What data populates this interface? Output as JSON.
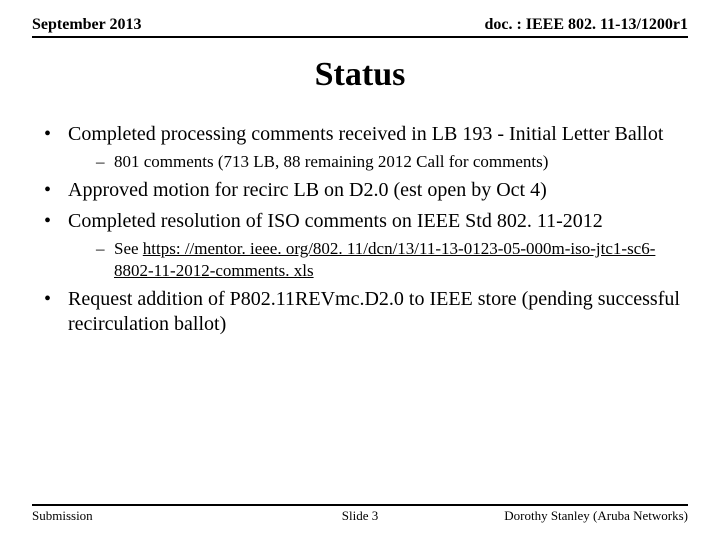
{
  "header": {
    "date": "September 2013",
    "docnum": "doc. : IEEE 802. 11-13/1200r1"
  },
  "title": "Status",
  "bullets": {
    "b1": "Completed processing comments received in LB 193 - Initial Letter Ballot",
    "b1_sub1": "801 comments (713 LB, 88 remaining 2012 Call for comments)",
    "b2": "Approved motion for recirc LB on D2.0 (est open by Oct 4)",
    "b3": "Completed resolution of ISO comments on IEEE Std 802. 11-2012",
    "b3_sub1_prefix": "See ",
    "b3_sub1_link": "https: //mentor. ieee. org/802. 11/dcn/13/11-13-0123-05-000m-iso-jtc1-sc6-8802-11-2012-comments. xls",
    "b4": "Request addition of P802.11REVmc.D2.0 to IEEE store (pending successful recirculation ballot)"
  },
  "footer": {
    "left": "Submission",
    "center": "Slide 3",
    "right": "Dorothy Stanley (Aruba Networks)"
  }
}
